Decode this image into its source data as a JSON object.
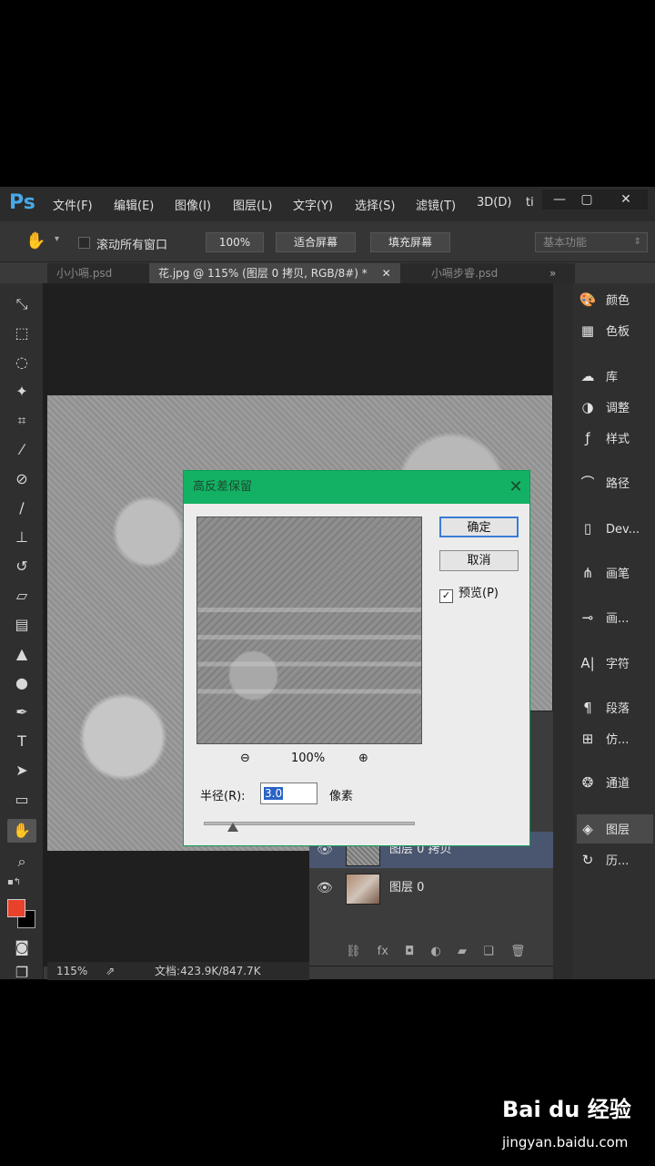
{
  "app": {
    "logo": "Ps"
  },
  "menu": [
    "文件(F)",
    "编辑(E)",
    "图像(I)",
    "图层(L)",
    "文字(Y)",
    "选择(S)",
    "滤镜(T)",
    "3D(D)",
    "ti"
  ],
  "window_controls": {
    "minimize": "—",
    "maximize": "▢",
    "close": "✕"
  },
  "options": {
    "scroll_all_label": "滚动所有窗口",
    "zoom_btn": "100%",
    "fit_screen_btn": "适合屏幕",
    "fill_screen_btn": "填充屏幕",
    "workspace": "基本功能"
  },
  "tabs": [
    {
      "label": "小小嗝.psd",
      "active": false
    },
    {
      "label": "花.jpg @ 115% (图层 0 拷贝, RGB/8#) *",
      "active": true
    },
    {
      "label": "小嗝步睿.psd",
      "active": false
    }
  ],
  "tools": [
    "move-icon",
    "marquee-icon",
    "lasso-icon",
    "magic-wand-icon",
    "crop-icon",
    "eyedropper-icon",
    "healing-brush-icon",
    "brush-icon",
    "stamp-icon",
    "history-brush-icon",
    "eraser-icon",
    "gradient-icon",
    "sharpen-icon",
    "dodge-icon",
    "pen-icon",
    "type-icon",
    "path-select-icon",
    "shape-icon",
    "hand-icon",
    "zoom-icon"
  ],
  "colors": {
    "foreground": "#e8412c",
    "background": "#000000"
  },
  "panels": [
    {
      "icon": "color-icon",
      "label": "颜色"
    },
    {
      "icon": "swatches-icon",
      "label": "色板"
    },
    {
      "icon": "libraries-icon",
      "label": "库"
    },
    {
      "icon": "adjustments-icon",
      "label": "调整"
    },
    {
      "icon": "styles-icon",
      "label": "样式"
    },
    {
      "icon": "paths-icon",
      "label": "路径"
    },
    {
      "icon": "device-preview-icon",
      "label": "Dev..."
    },
    {
      "icon": "brush-panel-icon",
      "label": "画笔"
    },
    {
      "icon": "brush-presets-icon",
      "label": "画..."
    },
    {
      "icon": "character-icon",
      "label": "字符"
    },
    {
      "icon": "paragraph-icon",
      "label": "段落"
    },
    {
      "icon": "clone-source-icon",
      "label": "仿..."
    },
    {
      "icon": "channels-icon",
      "label": "通道"
    },
    {
      "icon": "layers-icon",
      "label": "图层"
    },
    {
      "icon": "history-icon",
      "label": "历..."
    }
  ],
  "layers": [
    {
      "name": "图层 0 拷贝",
      "selected": true
    },
    {
      "name": "图层 0",
      "selected": false
    }
  ],
  "status": {
    "zoom": "115%",
    "doc": "文档:423.9K/847.7K"
  },
  "dialog": {
    "title": "高反差保留",
    "ok": "确定",
    "cancel": "取消",
    "preview_label": "预览(P)",
    "preview_checked": true,
    "zoom": "100%",
    "radius_label": "半径(R):",
    "radius_value": "3.0",
    "radius_unit": "像素",
    "radius_fraction": 0.14
  },
  "watermark": {
    "brand": "Bai du 经验",
    "url": "jingyan.baidu.com"
  }
}
